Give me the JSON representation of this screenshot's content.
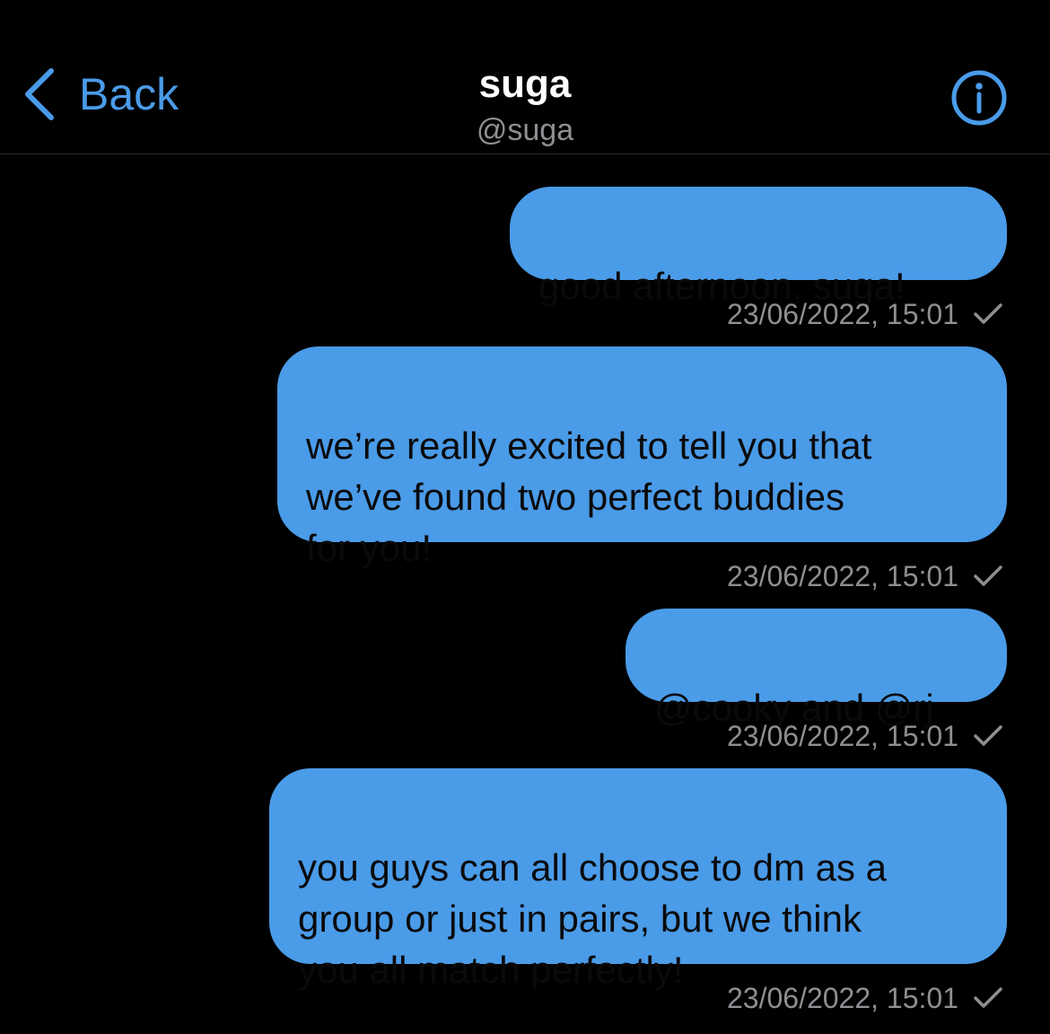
{
  "header": {
    "back_label": "Back",
    "title": "suga",
    "handle": "@suga"
  },
  "messages": [
    {
      "text": "good afternoon, suga!",
      "timestamp": "23/06/2022, 15:01",
      "status_icon": "check-icon"
    },
    {
      "text": "we’re really excited to tell you that\nwe’ve found two perfect buddies\nfor you!",
      "timestamp": "23/06/2022, 15:01",
      "status_icon": "check-icon"
    },
    {
      "text": "@cooky and @rj",
      "timestamp": "23/06/2022, 15:01",
      "status_icon": "check-icon"
    },
    {
      "text": "you guys can all choose to dm as a\ngroup or just in pairs, but we think\nyou all match perfectly!",
      "timestamp": "23/06/2022, 15:01",
      "status_icon": "check-icon"
    }
  ],
  "colors": {
    "background": "#000000",
    "accent": "#4a9be8",
    "bubble": "#4a9be8",
    "secondary_text": "#8e8e93"
  }
}
